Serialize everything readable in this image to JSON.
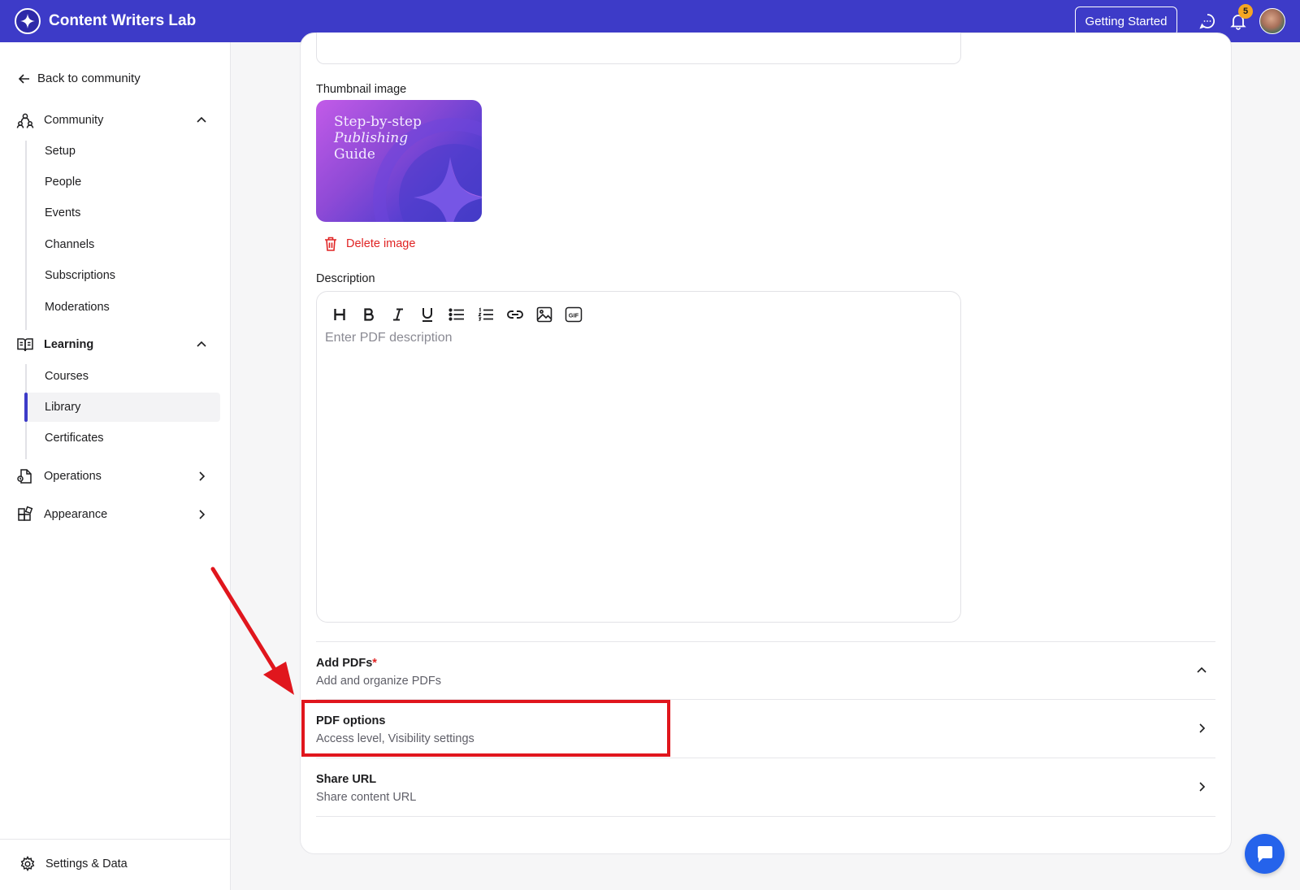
{
  "header": {
    "brand_title": "Content Writers Lab",
    "getting_started_label": "Getting Started",
    "notification_count": "5",
    "bg_color": "#3d3bc8"
  },
  "sidebar": {
    "back_label": "Back to community",
    "community": {
      "label": "Community",
      "items": [
        "Setup",
        "People",
        "Events",
        "Channels",
        "Subscriptions",
        "Moderations"
      ]
    },
    "learning": {
      "label": "Learning",
      "items": [
        "Courses",
        "Library",
        "Certificates"
      ],
      "active": "Library"
    },
    "operations_label": "Operations",
    "appearance_label": "Appearance",
    "settings_label": "Settings & Data"
  },
  "form": {
    "thumbnail_label": "Thumbnail image",
    "thumbnail_text": {
      "line1": "Step-by-step",
      "line2": "Publishing",
      "line3": "Guide"
    },
    "delete_image_label": "Delete image",
    "description_label": "Description",
    "description_placeholder": "Enter PDF description",
    "toolbar_icons": [
      "heading-icon",
      "bold-icon",
      "italic-icon",
      "underline-icon",
      "bullet-list-icon",
      "numbered-list-icon",
      "link-icon",
      "image-icon",
      "gif-icon"
    ]
  },
  "sections": {
    "add_pdfs": {
      "title": "Add PDFs",
      "required_mark": "*",
      "subtitle": "Add and organize PDFs"
    },
    "pdf_options": {
      "title": "PDF options",
      "subtitle": "Access level, Visibility settings"
    },
    "share_url": {
      "title": "Share URL",
      "subtitle": "Share content URL"
    }
  },
  "colors": {
    "accent": "#3d3bc8",
    "danger": "#e02424",
    "annotation": "#e0161d",
    "chat_fab": "#2563eb"
  }
}
